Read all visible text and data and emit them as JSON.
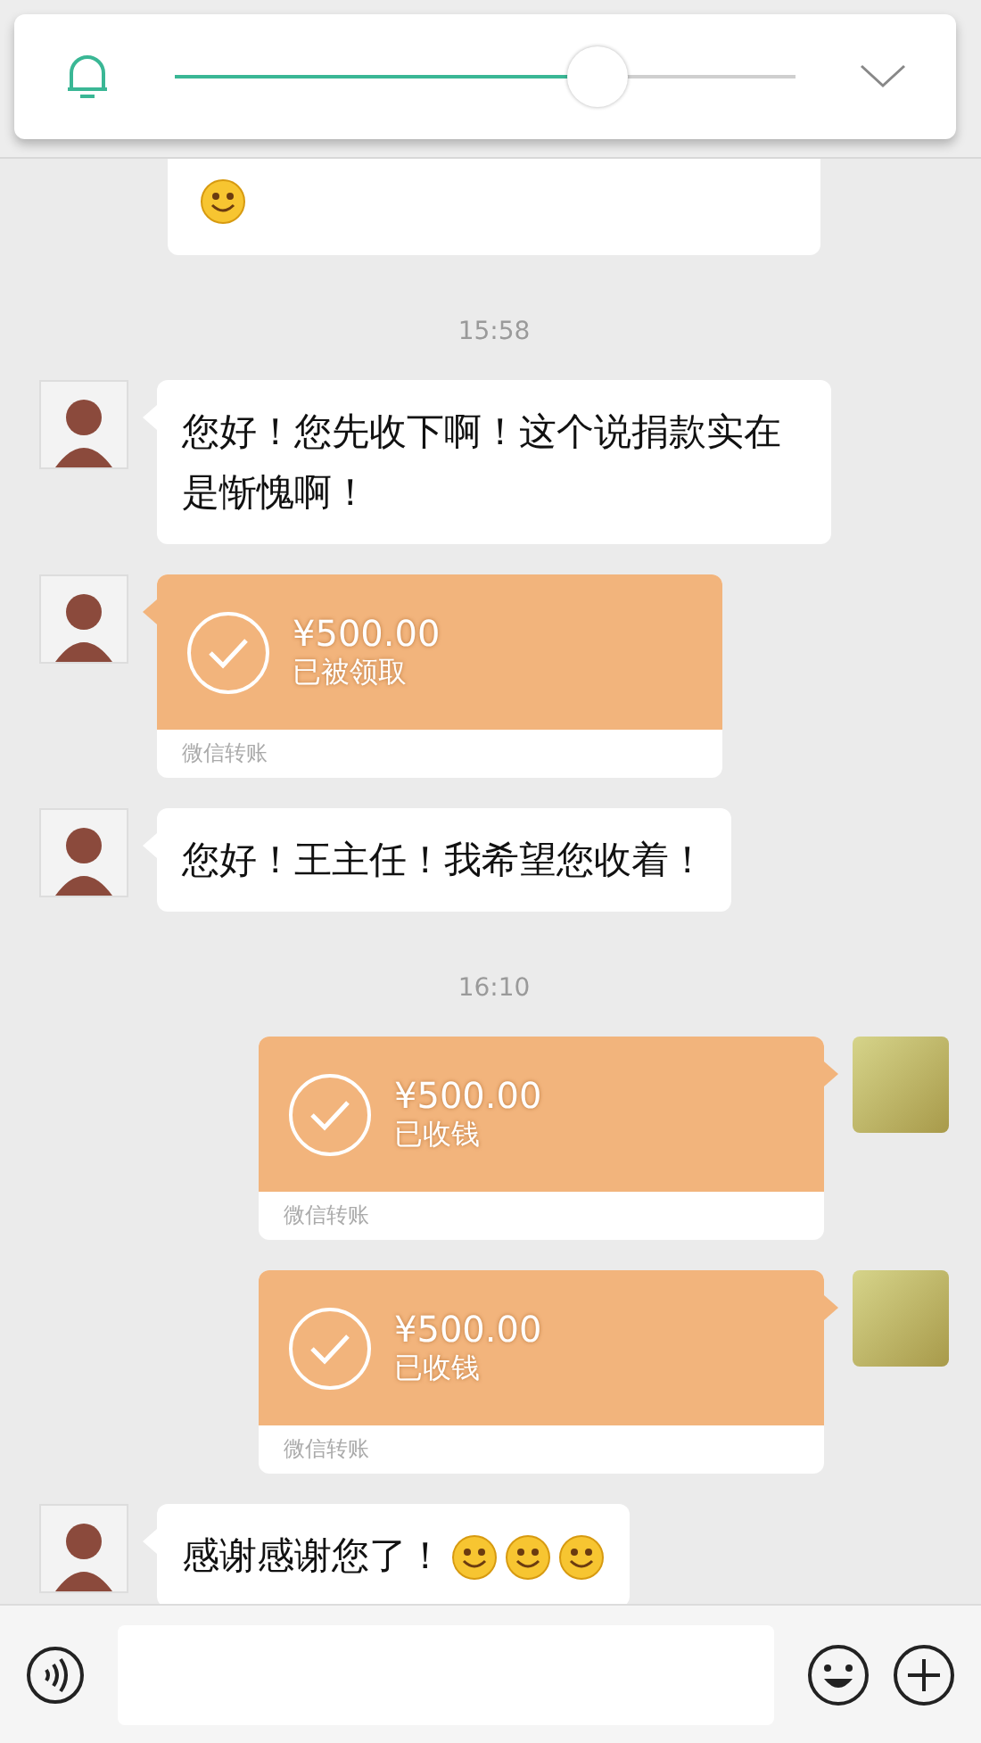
{
  "volume_popup": {
    "level": 0.68
  },
  "messages": [
    {
      "kind": "text",
      "outgoing": false,
      "cut_top": true,
      "emoji": [
        {
          "kind": "smile"
        }
      ]
    },
    {
      "kind": "time",
      "text": "15:58"
    },
    {
      "kind": "text",
      "outgoing": false,
      "text": "您好！您先收下啊！这个说捐款实在是惭愧啊！"
    },
    {
      "kind": "transfer",
      "outgoing": false,
      "amount": "¥500.00",
      "status": "已被领取",
      "footer": "微信转账"
    },
    {
      "kind": "text",
      "outgoing": false,
      "text": "您好！王主任！我希望您收着！"
    },
    {
      "kind": "time",
      "text": "16:10"
    },
    {
      "kind": "transfer",
      "outgoing": true,
      "amount": "¥500.00",
      "status": "已收钱",
      "footer": "微信转账"
    },
    {
      "kind": "transfer",
      "outgoing": true,
      "amount": "¥500.00",
      "status": "已收钱",
      "footer": "微信转账"
    },
    {
      "kind": "text",
      "outgoing": false,
      "text": "感谢感谢您了！",
      "emoji": [
        {
          "kind": "smile"
        },
        {
          "kind": "smile"
        },
        {
          "kind": "smile"
        }
      ]
    }
  ]
}
